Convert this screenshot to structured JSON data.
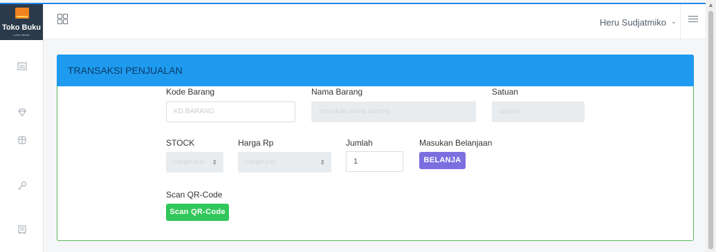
{
  "brand": {
    "name": "Toko Buku",
    "sub": "Lorem Media"
  },
  "header": {
    "user_name": "Heru Sudjatmiko"
  },
  "card": {
    "title": "TRANSAKSI PENJUALAN"
  },
  "form": {
    "kode_label": "Kode Barang",
    "kode_placeholder": "KD BARANG",
    "nama_label": "Nama Barang",
    "nama_placeholder": "masukan nama barang",
    "satuan_label": "Satuan",
    "satuan_placeholder": "satuan",
    "stock_label": "STOCK",
    "stock_placeholder": "harga pok",
    "harga_label": "Harga Rp",
    "harga_placeholder": "harga jual",
    "jumlah_label": "Jumlah",
    "jumlah_value": "1",
    "masukan_label": "Masukan Belanjaan",
    "belanja_button": "BELANJA",
    "scan_label": "Scan QR-Code",
    "scan_button": "Scan QR-Code"
  },
  "colors": {
    "header_blue": "#1e9bef",
    "card_border": "#5cb85c",
    "belanja": "#7b6fe0",
    "scan": "#31c75a"
  },
  "icons": [
    "dashboard-icon",
    "gem-icon",
    "package-icon",
    "key-icon",
    "cart-icon",
    "grid-icon",
    "chevron-down-icon",
    "menu-icon"
  ]
}
